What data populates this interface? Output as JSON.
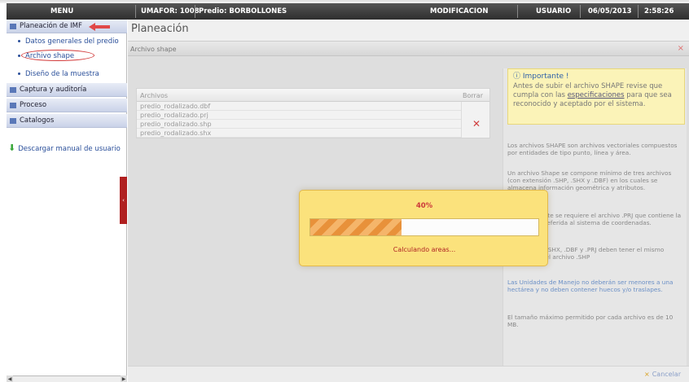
{
  "topbar": {
    "menu_label": "MENU",
    "umafor": "UMAFOR: 1008",
    "predio": "Predio: BORBOLLONES",
    "mode": "MODIFICACION",
    "user": "USUARIO",
    "date": "06/05/2013",
    "time": "2:58:26"
  },
  "sidebar": {
    "sections": [
      {
        "label": "Planeación de IMF"
      },
      {
        "label": "Captura y auditoría"
      },
      {
        "label": "Proceso"
      },
      {
        "label": "Catalogos"
      }
    ],
    "subitems": [
      {
        "label": "Datos generales del predio"
      },
      {
        "label": "Archivo shape"
      },
      {
        "label": "Diseño de la muestra"
      }
    ],
    "download_label": "Descargar manual de usuario",
    "collapse_glyph": "‹"
  },
  "main": {
    "title": "Planeación",
    "subheader": "Archivo shape",
    "close_glyph": "×",
    "table": {
      "col_files": "Archivos",
      "col_delete": "Borrar",
      "delete_glyph": "✕",
      "rows": [
        "predio_rodalizado.dbf",
        "predio_rodalizado.prj",
        "predio_rodalizado.shp",
        "predio_rodalizado.shx"
      ]
    },
    "info": {
      "important_title": "Importante !",
      "important_text_1": "Antes de subir el archivo SHAPE revise que cumpla con las",
      "important_link": "especificaciones",
      "important_text_2": "para que sea reconocido y aceptado por el sistema.",
      "p1": "Los archivos SHAPE son archivos vectoriales compuestos por entidades de tipo punto, línea y área.",
      "p2": "Un archivo Shape se compone mínimo de tres archivos (con extensión .SHP, .SHX y .DBF) en los cuales se almacena información geométrica y atributos.",
      "p3": "Adicionalmente se requiere el archivo .PRJ que contiene la información referida al sistema de coordenadas.",
      "p4": "Los archivos .SHX, .DBF y .PRJ deben tener el mismo nombre que el archivo .SHP",
      "p5": "Las Unidades de Manejo no deberán ser menores a una hectárea y no deben contener huecos y/o traslapes.",
      "p6": "El tamaño máximo permitido por cada archivo es de 10 MB."
    },
    "cancel_label": "Cancelar",
    "cancel_glyph": "×"
  },
  "progress": {
    "percent_label": "40%",
    "value": 0.4,
    "message": "Calculando areas..."
  },
  "colors": {
    "topbar": "#3a3a3a",
    "accent_red": "#d23a3a",
    "modal_bg": "#fbe27c",
    "progress_fill": "#e8913a",
    "link_blue": "#2a4f9a"
  }
}
